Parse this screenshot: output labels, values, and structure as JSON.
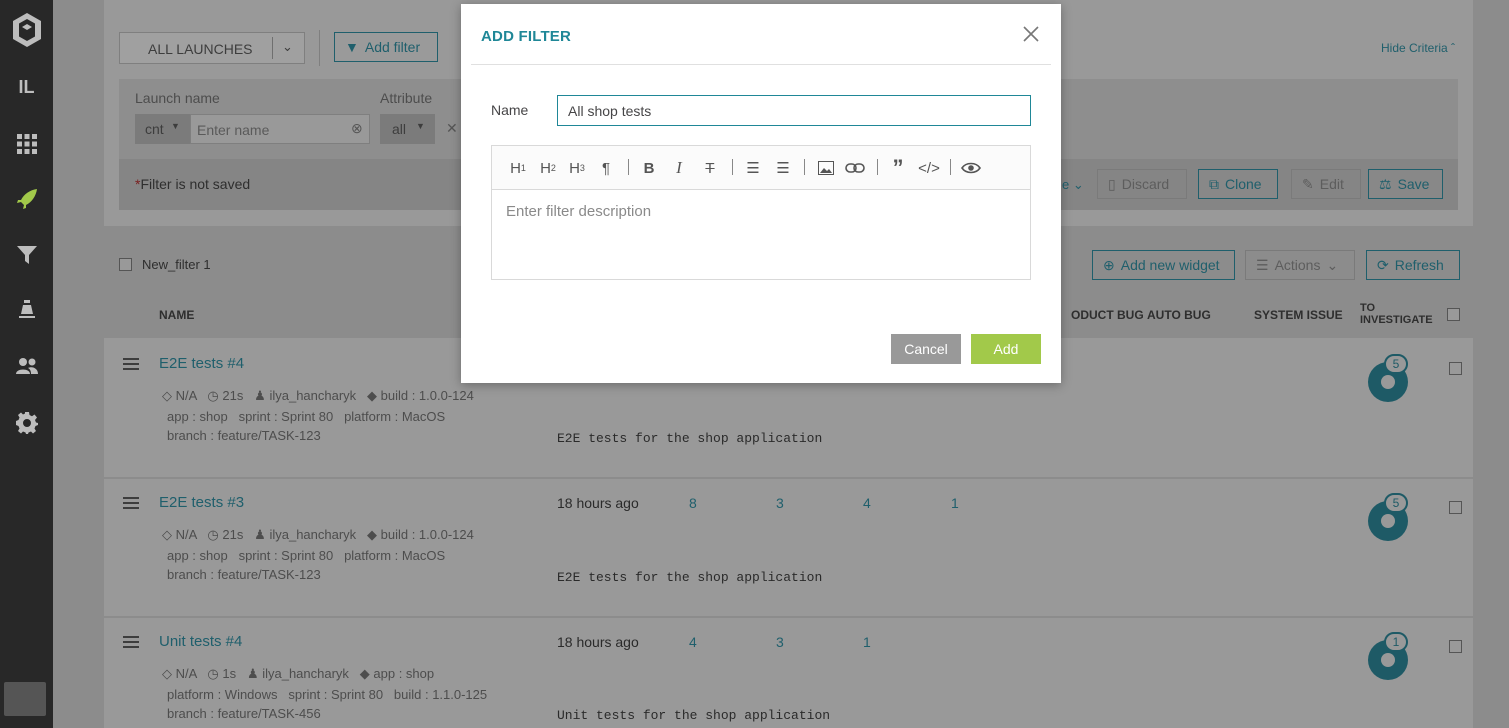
{
  "sidebar": {
    "items": [
      {
        "icon": "logo-icon"
      },
      {
        "icon": "initials-icon",
        "label": "IL"
      },
      {
        "icon": "dashboard-icon"
      },
      {
        "icon": "launches-icon"
      },
      {
        "icon": "filters-icon"
      },
      {
        "icon": "debug-icon"
      },
      {
        "icon": "members-icon"
      },
      {
        "icon": "settings-icon"
      }
    ]
  },
  "filter_bar": {
    "launches_select": "ALL LAUNCHES",
    "add_filter": "Add filter",
    "hide_criteria": "Hide Criteria",
    "launch_name_label": "Launch name",
    "attribute_label": "Attribute",
    "cnt_select": "cnt",
    "name_placeholder": "Enter name",
    "all_select": "all",
    "not_saved": "Filter is not saved",
    "not_saved_star": "*",
    "more_tail": "e",
    "discard": "Discard",
    "clone": "Clone",
    "edit": "Edit",
    "save": "Save"
  },
  "list_header": {
    "filter_name": "New_filter 1",
    "add_widget": "Add new widget",
    "actions": "Actions",
    "refresh": "Refresh",
    "col_name": "NAME",
    "col_product_bug": "ODUCT BUG",
    "col_auto_bug": "AUTO BUG",
    "col_system_issue": "SYSTEM ISSUE",
    "col_to_investigate_1": "TO",
    "col_to_investigate_2": "INVESTIGATE"
  },
  "rows": [
    {
      "name": "E2E tests #4",
      "na": "N/A",
      "duration": "21s",
      "owner": "ilya_hancharyk",
      "attrs_line1_extra": "build : 1.0.0-124",
      "attrs_line2": [
        "app : shop",
        "sprint : Sprint 80",
        "platform : MacOS"
      ],
      "attrs_line3": "branch : feature/TASK-123",
      "time": "",
      "counts": [
        "",
        "",
        "",
        ""
      ],
      "description": "E2E tests for the shop application",
      "to_investigate": "5"
    },
    {
      "name": "E2E tests #3",
      "na": "N/A",
      "duration": "21s",
      "owner": "ilya_hancharyk",
      "attrs_line1_extra": "build : 1.0.0-124",
      "attrs_line2": [
        "app : shop",
        "sprint : Sprint 80",
        "platform : MacOS"
      ],
      "attrs_line3": "branch : feature/TASK-123",
      "time": "18 hours ago",
      "counts": [
        "8",
        "3",
        "4",
        "1"
      ],
      "description": "E2E tests for the shop application",
      "to_investigate": "5"
    },
    {
      "name": "Unit tests #4",
      "na": "N/A",
      "duration": "1s",
      "owner": "ilya_hancharyk",
      "attrs_line1_extra": "app : shop",
      "attrs_line2": [
        "platform : Windows",
        "sprint : Sprint 80",
        "build : 1.1.0-125"
      ],
      "attrs_line3": "branch : feature/TASK-456",
      "time": "18 hours ago",
      "counts": [
        "4",
        "3",
        "1",
        ""
      ],
      "description": "Unit tests for the shop application",
      "to_investigate": "1"
    }
  ],
  "modal": {
    "title": "ADD FILTER",
    "name_label": "Name",
    "name_value": "All shop tests",
    "description_placeholder": "Enter filter description",
    "toolbar": [
      "H1",
      "H2",
      "H3",
      "paragraph",
      "bold",
      "italic",
      "strikethrough",
      "bullet-list",
      "numbered-list",
      "image",
      "link",
      "quote",
      "code",
      "preview"
    ],
    "cancel": "Cancel",
    "add": "Add"
  },
  "colors": {
    "accent": "#1f8797",
    "add_button": "#a2c94a",
    "cancel_button": "#999999",
    "sidebar": "#282828"
  }
}
